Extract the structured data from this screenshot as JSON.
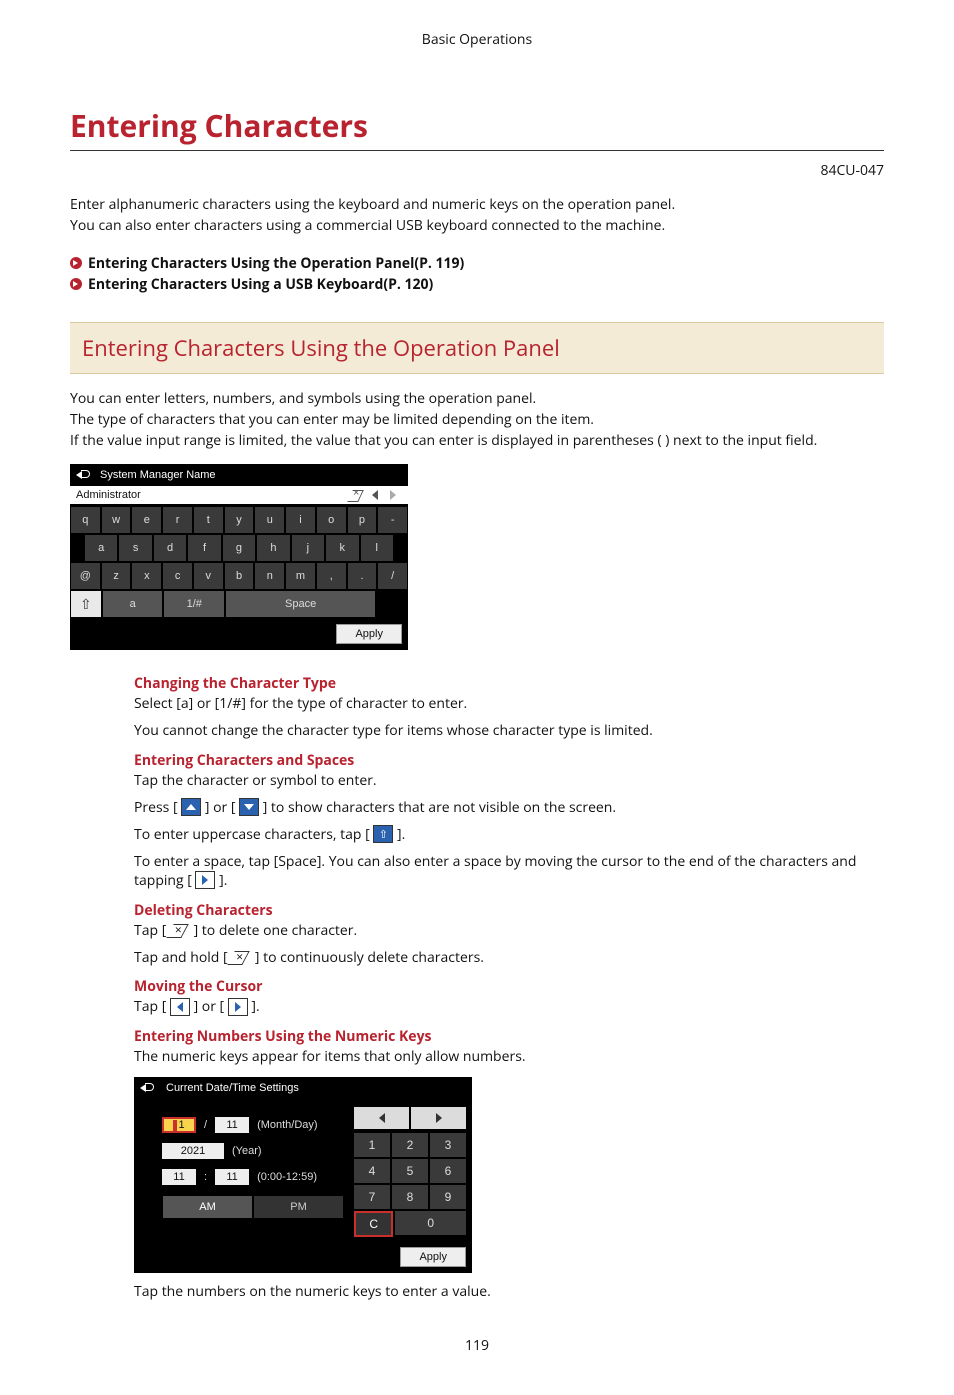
{
  "header": "Basic Operations",
  "title": "Entering Characters",
  "doc_code": "84CU-047",
  "intro1": "Enter alphanumeric characters using the keyboard and numeric keys on the operation panel.",
  "intro2": "You can also enter characters using a commercial USB keyboard connected to the machine.",
  "toc1": "Entering Characters Using the Operation Panel(P. 119)",
  "toc2": "Entering Characters Using a USB Keyboard(P. 120)",
  "section1_title": "Entering Characters Using the Operation Panel",
  "sec1_p1": "You can enter letters, numbers, and symbols using the operation panel.",
  "sec1_p2": "The type of characters that you can enter may be limited depending on the item.",
  "sec1_p3": "If the value input range is limited, the value that you can enter is displayed in parentheses ( ) next to the input field.",
  "kb": {
    "title": "System Manager Name",
    "field": "Administrator",
    "rows": {
      "r1": [
        "q",
        "w",
        "e",
        "r",
        "t",
        "y",
        "u",
        "i",
        "o",
        "p",
        "-"
      ],
      "r2": [
        "a",
        "s",
        "d",
        "f",
        "g",
        "h",
        "j",
        "k",
        "l"
      ],
      "r3": [
        "@",
        "z",
        "x",
        "c",
        "v",
        "b",
        "n",
        "m",
        ",",
        ".",
        "/"
      ]
    },
    "shift": "⇧",
    "mode_a": "a",
    "mode_1": "1/#",
    "space": "Space",
    "apply": "Apply"
  },
  "sub_change_type": "Changing the Character Type",
  "change_type_1": "Select [a] or [1/#] for the type of character to enter.",
  "change_type_2": "You cannot change the character type for items whose character type is limited.",
  "sub_enter_chars": "Entering Characters and Spaces",
  "enter_chars_1": "Tap the character or symbol to enter.",
  "enter_chars_press_a": "Press [",
  "enter_chars_press_b": "] or [",
  "enter_chars_press_c": "] to show characters that are not visible on the screen.",
  "upper_a": "To enter uppercase characters, tap [",
  "upper_b": "].",
  "space_a": "To enter a space, tap [Space]. You can also enter a space by moving the cursor to the end of the characters and tapping [",
  "space_b": "].",
  "sub_delete": "Deleting Characters",
  "delete_a": "Tap [ ",
  "delete_b": " ] to delete one character.",
  "delete_hold_a": "Tap and hold [ ",
  "delete_hold_b": " ] to continuously delete characters.",
  "sub_cursor": "Moving the Cursor",
  "cursor_a": "Tap [",
  "cursor_b": "] or [",
  "cursor_c": "].",
  "sub_numeric": "Entering Numbers Using the Numeric Keys",
  "numeric_intro": "The numeric keys appear for items that only allow numbers.",
  "num": {
    "title": "Current Date/Time Settings",
    "month": "1",
    "sep1": "/",
    "day": "11",
    "md_label": "(Month/Day)",
    "year": "2021",
    "year_label": "(Year)",
    "h": "11",
    "sep2": ":",
    "m": "11",
    "time_label": "(0:00-12:59)",
    "am": "AM",
    "pm": "PM",
    "keys": [
      "1",
      "2",
      "3",
      "4",
      "5",
      "6",
      "7",
      "8",
      "9"
    ],
    "c": "C",
    "zero": "0",
    "apply": "Apply"
  },
  "numeric_after": "Tap the numbers on the numeric keys to enter a value.",
  "page_number": "119"
}
